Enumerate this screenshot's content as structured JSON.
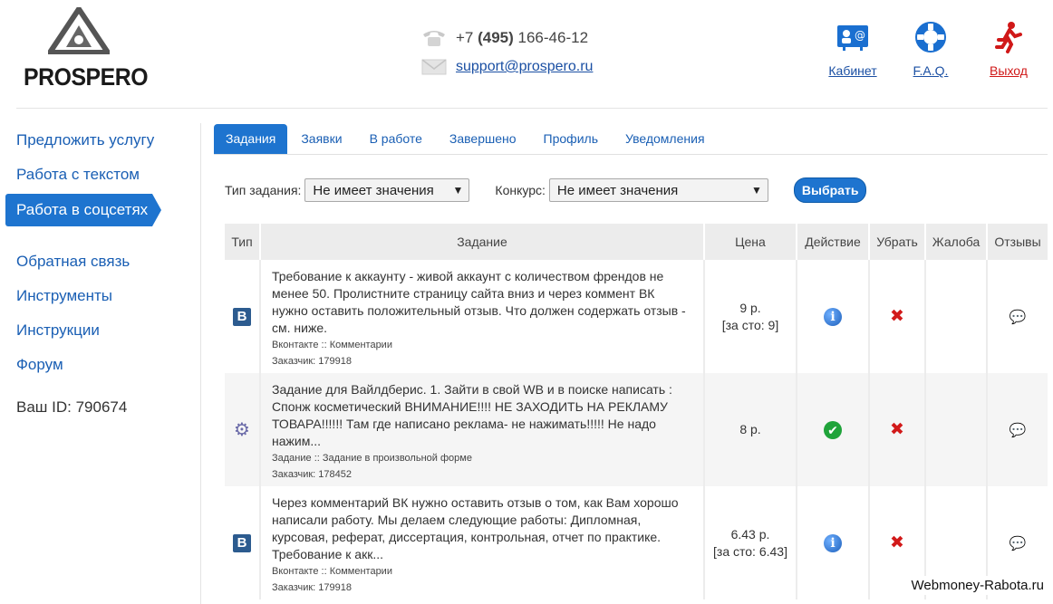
{
  "header": {
    "logo_text": "PROSPERO",
    "phone_prefix": "+7 ",
    "phone_code": "(495)",
    "phone_number": " 166-46-12",
    "email": "support@prospero.ru",
    "nav": [
      {
        "label": "Кабинет",
        "icon": "cabinet-icon"
      },
      {
        "label": "F.A.Q.",
        "icon": "lifebuoy-icon"
      },
      {
        "label": "Выход",
        "icon": "running-man-icon"
      }
    ]
  },
  "sidebar": {
    "items": [
      "Предложить услугу",
      "Работа с текстом",
      "Работа в соцсетях"
    ],
    "items2": [
      "Обратная связь",
      "Инструменты",
      "Инструкции",
      "Форум"
    ],
    "user_id": "Ваш ID: 790674"
  },
  "tabs": [
    "Задания",
    "Заявки",
    "В работе",
    "Завершено",
    "Профиль",
    "Уведомления"
  ],
  "filters": {
    "type_label": "Тип задания:",
    "type_value": "Не имеет значения",
    "contest_label": "Конкурс:",
    "contest_value": "Не имеет значения",
    "submit": "Выбрать"
  },
  "table": {
    "headers": [
      "Тип",
      "Задание",
      "Цена",
      "Действие",
      "Убрать",
      "Жалоба",
      "Отзывы"
    ],
    "rows": [
      {
        "type_icon": "vk-icon",
        "type_glyph": "B",
        "text": "Требование к аккаунту - живой аккаунт с количеством френдов не менее 50. Пролистните страницу сайта вниз и через коммент ВК нужно оставить положительный отзыв. Что должен содержать отзыв - см. ниже.",
        "category": "Вконтакте :: Комментарии",
        "customer": "Заказчик: 179918",
        "price": "9 р.",
        "price_sub": "[за сто: 9]",
        "action": "info"
      },
      {
        "type_icon": "gear-icon",
        "type_glyph": "⚙",
        "text": "Задание для Вайлдберис. 1. Зайти в свой WB и в поиске написать : Спонж косметический ВНИМАНИЕ!!!! НЕ ЗАХОДИТЬ НА РЕКЛАМУ ТОВАРА!!!!!! Там где написано реклама- не нажимать!!!!! Не надо нажим...",
        "category": "Задание :: Задание в произвольной форме",
        "customer": "Заказчик: 178452",
        "price": "8 р.",
        "price_sub": "",
        "action": "ok"
      },
      {
        "type_icon": "vk-icon",
        "type_glyph": "B",
        "text": "Через комментарий ВК нужно оставить отзыв о том, как Вам хорошо написали работу. Мы делаем следующие работы: Дипломная, курсовая, реферат, диссертация, контрольная, отчет по практике. Требование к акк...",
        "category": "Вконтакте :: Комментарии",
        "customer": "Заказчик: 179918",
        "price": "6.43 р.",
        "price_sub": "[за сто: 6.43]",
        "action": "info"
      }
    ]
  },
  "watermark": "Webmoney-Rabota.ru"
}
